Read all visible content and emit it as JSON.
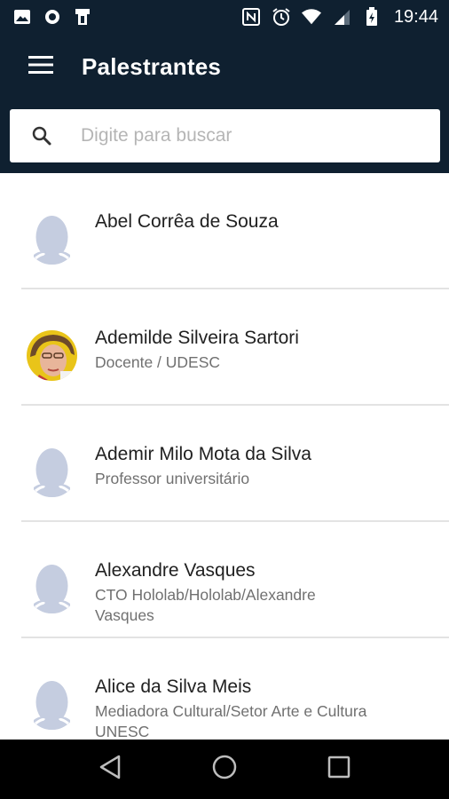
{
  "status_bar": {
    "time": "19:44",
    "left_icons": [
      "image-icon",
      "circle-icon",
      "phone-icon"
    ],
    "right_icons": [
      "nfc-icon",
      "alarm-icon",
      "wifi-icon",
      "signal-icon",
      "battery-icon"
    ]
  },
  "app_bar": {
    "title": "Palestrantes",
    "menu_icon": "menu-icon"
  },
  "search": {
    "placeholder": "Digite para buscar",
    "value": ""
  },
  "speakers": [
    {
      "name": "Abel Corrêa de Souza",
      "role": "",
      "has_photo": false
    },
    {
      "name": "Ademilde Silveira Sartori",
      "role": "Docente / UDESC",
      "has_photo": true
    },
    {
      "name": "Ademir Milo Mota da Silva",
      "role": "Professor universitário",
      "has_photo": false
    },
    {
      "name": "Alexandre Vasques",
      "role": "CTO Hololab/Hololab/Alexandre Vasques",
      "has_photo": false
    },
    {
      "name": "Alice da Silva Meis",
      "role": "Mediadora Cultural/Setor Arte e Cultura UNESC",
      "has_photo": false
    }
  ],
  "colors": {
    "primary": "#0f2030",
    "avatar_placeholder": "#c5cde0",
    "divider": "#e3e3e3"
  },
  "nav_bar": {
    "icons": [
      "back-icon",
      "home-icon",
      "recents-icon"
    ]
  }
}
